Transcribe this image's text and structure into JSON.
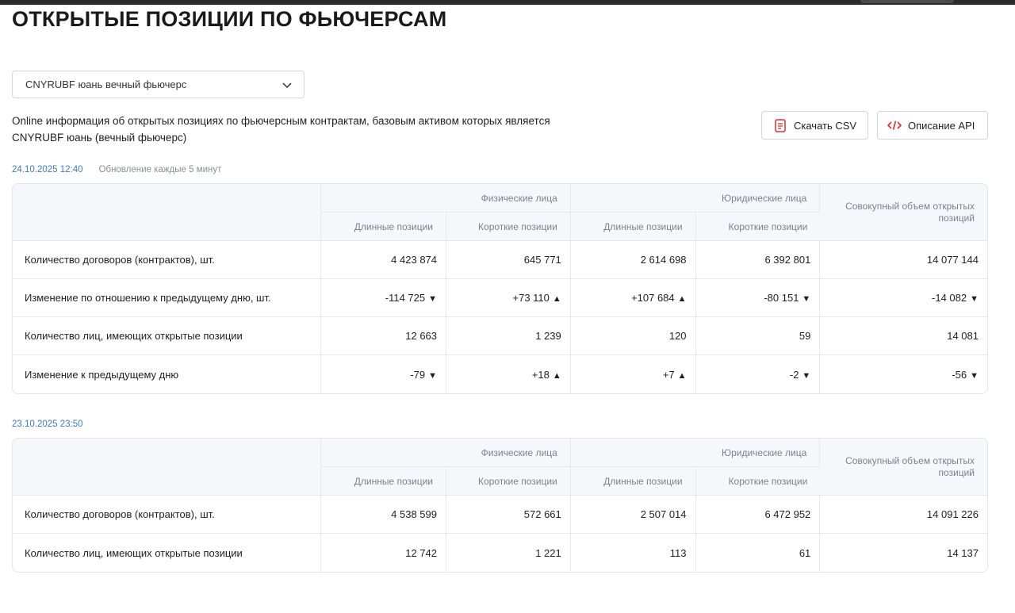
{
  "page": {
    "title": "ОТКРЫТЫЕ ПОЗИЦИИ ПО ФЬЮЧЕРСАМ",
    "select_value": "CNYRUBF юань вечный фьючерс",
    "description": "Online информация об открытых позициях по фьючерсным контрактам, базовым активом которых является CNYRUBF юань (вечный фьючерс)",
    "buttons": {
      "csv": "Скачать CSV",
      "api": "Описание API"
    },
    "colors": {
      "accent": "#d6312b",
      "positive": "#2e9b3f",
      "negative": "#d6312b",
      "date": "#3c7ac0"
    },
    "icons": {
      "select": "chevron-down-icon",
      "csv": "document-icon",
      "api": "code-icon"
    }
  },
  "headers": {
    "individuals": "Физические лица",
    "legal": "Юридические лица",
    "long": "Длинные позиции",
    "short": "Короткие позиции",
    "total": "Совокупный объем открытых позиций"
  },
  "current": {
    "date": "24.10.2025 12:40",
    "update_note": "Обновление каждые 5 минут",
    "rows": [
      {
        "label": "Количество договоров (контрактов), шт.",
        "values": [
          "4 423 874",
          "645 771",
          "2 614 698",
          "6 392 801",
          "14 077 144"
        ]
      },
      {
        "label": "Изменение по отношению к предыдущему дню, шт.",
        "values": [
          "-114 725",
          "+73 110",
          "+107 684",
          "-80 151",
          "-14 082"
        ]
      },
      {
        "label": "Количество лиц, имеющих открытые позиции",
        "values": [
          "12 663",
          "1 239",
          "120",
          "59",
          "14 081"
        ]
      },
      {
        "label": "Изменение к предыдущему дню",
        "values": [
          "-79",
          "+18",
          "+7",
          "-2",
          "-56"
        ]
      }
    ]
  },
  "previous": {
    "date": "23.10.2025 23:50",
    "rows": [
      {
        "label": "Количество договоров (контрактов), шт.",
        "values": [
          "4 538 599",
          "572 661",
          "2 507 014",
          "6 472 952",
          "14 091 226"
        ]
      },
      {
        "label": "Количество лиц, имеющих открытые позиции",
        "values": [
          "12 742",
          "1 221",
          "113",
          "61",
          "14 137"
        ]
      }
    ]
  }
}
